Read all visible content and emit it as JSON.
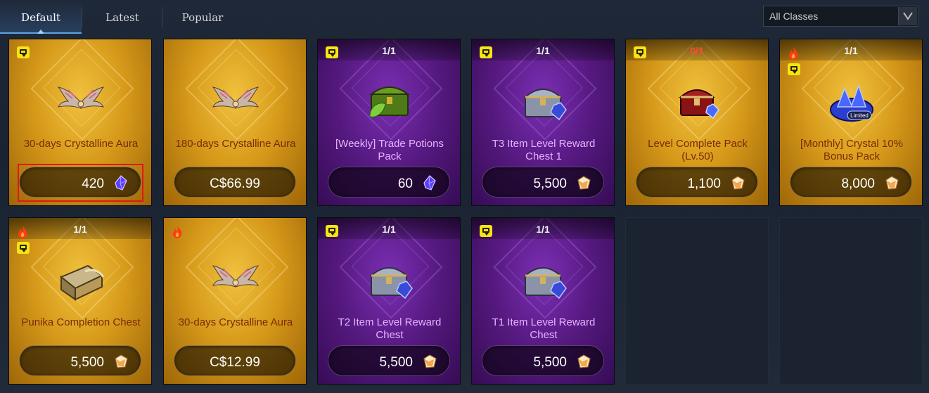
{
  "tabs": [
    {
      "label": "Default",
      "active": true
    },
    {
      "label": "Latest",
      "active": false
    },
    {
      "label": "Popular",
      "active": false
    }
  ],
  "filter": {
    "selected": "All Classes"
  },
  "colors": {
    "accent": "#5fa3e6",
    "gold_card": "#d79a1a",
    "purple_card": "#55197f",
    "highlight": "#e01818",
    "sold_out": "#ff4a3a"
  },
  "products": [
    {
      "name": "30-days Crystalline Aura",
      "price": "420",
      "currency": "royal-crystal-icon",
      "theme": "gold",
      "quantity": "",
      "badges": [
        "chat-icon"
      ],
      "icon": "wings-icon",
      "selected": true
    },
    {
      "name": "180-days Crystalline Aura",
      "price": "C$66.99",
      "currency": "cash",
      "theme": "gold",
      "quantity": "",
      "badges": [],
      "icon": "wings-icon",
      "selected": false
    },
    {
      "name": "[Weekly] Trade Potions Pack",
      "price": "60",
      "currency": "royal-crystal-icon",
      "theme": "purple",
      "quantity": "1/1",
      "badges": [
        "chat-icon"
      ],
      "icon": "green-chest-icon",
      "selected": false
    },
    {
      "name": "T3 Item Level Reward Chest 1",
      "price": "5,500",
      "currency": "silver-gem-icon",
      "theme": "purple",
      "quantity": "1/1",
      "badges": [
        "chat-icon"
      ],
      "icon": "silver-chest-icon",
      "selected": false
    },
    {
      "name": "Level Complete Pack (Lv.50)",
      "price": "1,100",
      "currency": "silver-gem-icon",
      "theme": "gold",
      "quantity": "0/1",
      "badges": [
        "chat-icon"
      ],
      "icon": "red-chest-icon",
      "selected": false
    },
    {
      "name": "[Monthly] Crystal 10% Bonus Pack",
      "price": "8,000",
      "currency": "silver-gem-icon",
      "theme": "gold",
      "quantity": "1/1",
      "badges": [
        "fire-icon",
        "chat-icon"
      ],
      "icon": "crystal-pile-icon",
      "icon_text": "Limited",
      "selected": false
    },
    {
      "name": "Punika Completion Chest",
      "price": "5,500",
      "currency": "silver-gem-icon",
      "theme": "gold",
      "quantity": "1/1",
      "badges": [
        "fire-icon",
        "chat-icon"
      ],
      "icon": "gold-chest-icon",
      "selected": false
    },
    {
      "name": "30-days Crystalline Aura",
      "price": "C$12.99",
      "currency": "cash",
      "theme": "gold",
      "quantity": "",
      "badges": [
        "fire-icon"
      ],
      "icon": "wings-icon",
      "selected": false
    },
    {
      "name": "T2 Item Level Reward Chest",
      "price": "5,500",
      "currency": "silver-gem-icon",
      "theme": "purple",
      "quantity": "1/1",
      "badges": [
        "chat-icon"
      ],
      "icon": "silver-chest-icon",
      "selected": false
    },
    {
      "name": "T1 Item Level Reward Chest",
      "price": "5,500",
      "currency": "silver-gem-icon",
      "theme": "purple",
      "quantity": "1/1",
      "badges": [
        "chat-icon"
      ],
      "icon": "silver-chest-icon",
      "selected": false
    }
  ]
}
